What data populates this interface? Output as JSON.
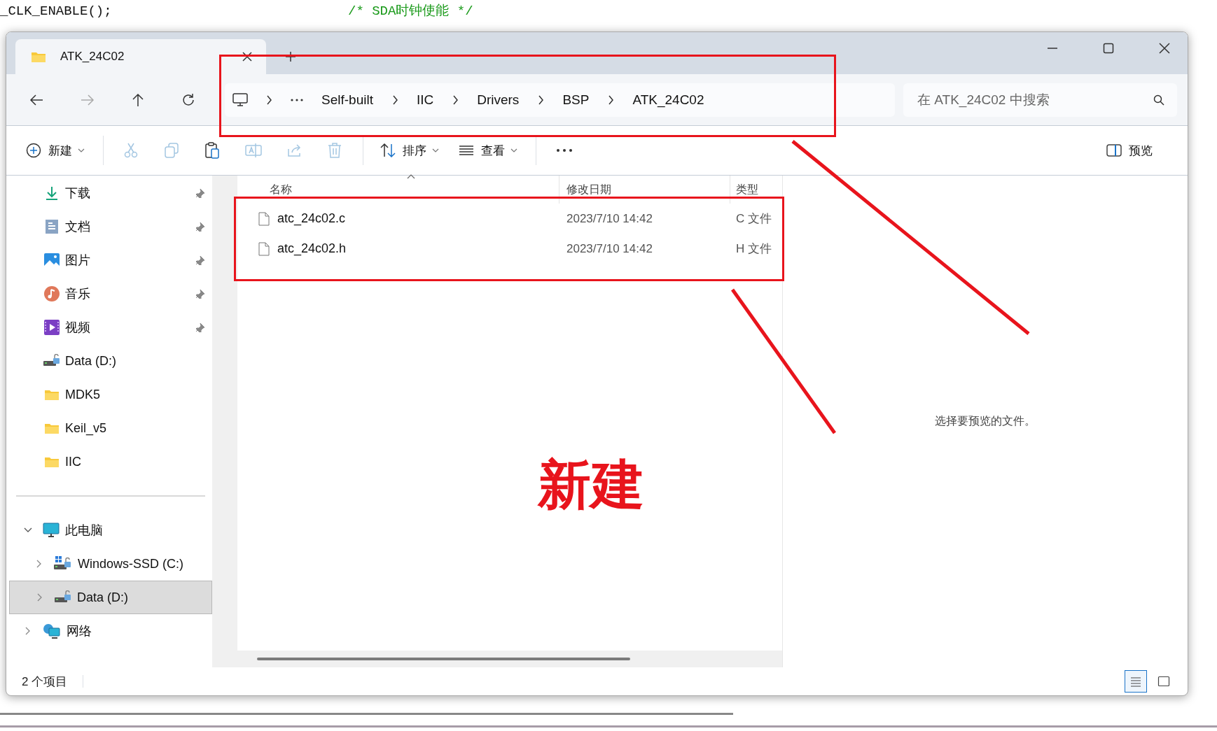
{
  "background_code": [
    {
      "code": "_CLK_ENABLE();",
      "comment": "/* SDA时钟使能 */"
    }
  ],
  "tabs": [
    {
      "title": "ATK_24C02",
      "selected": true
    }
  ],
  "address_bar": {
    "crumbs": [
      "Self-built",
      "IIC",
      "Drivers",
      "BSP",
      "ATK_24C02"
    ]
  },
  "search": {
    "placeholder": "在 ATK_24C02 中搜索"
  },
  "toolbar": [
    {
      "kind": "new",
      "label": "新建",
      "disabled": false
    },
    {
      "kind": "cut",
      "disabled": true
    },
    {
      "kind": "copy",
      "disabled": true
    },
    {
      "kind": "paste",
      "disabled": false
    },
    {
      "kind": "rename",
      "disabled": true
    },
    {
      "kind": "share",
      "disabled": true
    },
    {
      "kind": "delete",
      "disabled": true
    },
    {
      "kind": "sort",
      "label": "排序",
      "disabled": false
    },
    {
      "kind": "view",
      "label": "查看",
      "disabled": false
    },
    {
      "kind": "more",
      "disabled": false
    }
  ],
  "preview_button": {
    "label": "预览"
  },
  "sidebar": {
    "quick_access": [
      {
        "kind": "download",
        "label": "下载",
        "pinned": true
      },
      {
        "kind": "documents",
        "label": "文档",
        "pinned": true
      },
      {
        "kind": "pictures",
        "label": "图片",
        "pinned": true
      },
      {
        "kind": "music",
        "label": "音乐",
        "pinned": true
      },
      {
        "kind": "videos",
        "label": "视频",
        "pinned": true
      },
      {
        "kind": "drive",
        "label": "Data (D:)",
        "pinned": false
      },
      {
        "kind": "folder",
        "label": "MDK5",
        "pinned": false
      },
      {
        "kind": "folder",
        "label": "Keil_v5",
        "pinned": false
      },
      {
        "kind": "folder",
        "label": "IIC",
        "pinned": false
      }
    ],
    "tree": [
      {
        "kind": "pc",
        "label": "此电脑",
        "expanded": true,
        "selected": false,
        "children": [
          {
            "kind": "windrive",
            "label": "Windows-SSD (C:)",
            "expanded": false,
            "selected": false
          },
          {
            "kind": "drive",
            "label": "Data (D:)",
            "expanded": false,
            "selected": true
          }
        ]
      },
      {
        "kind": "network",
        "label": "网络",
        "expanded": false,
        "selected": false
      }
    ]
  },
  "table": {
    "columns": [
      "名称",
      "修改日期",
      "类型"
    ],
    "rows": [
      {
        "name": "atc_24c02.c",
        "modified": "2023/7/10 14:42",
        "type": "C 文件"
      },
      {
        "name": "atc_24c02.h",
        "modified": "2023/7/10 14:42",
        "type": "H 文件"
      }
    ]
  },
  "preview_pane": {
    "message": "选择要预览的文件。"
  },
  "status_bar": {
    "count": "2 个项目",
    "views": [
      {
        "kind": "details",
        "selected": true
      },
      {
        "kind": "tiles",
        "selected": false
      }
    ]
  },
  "annotation": {
    "label": "新建"
  }
}
